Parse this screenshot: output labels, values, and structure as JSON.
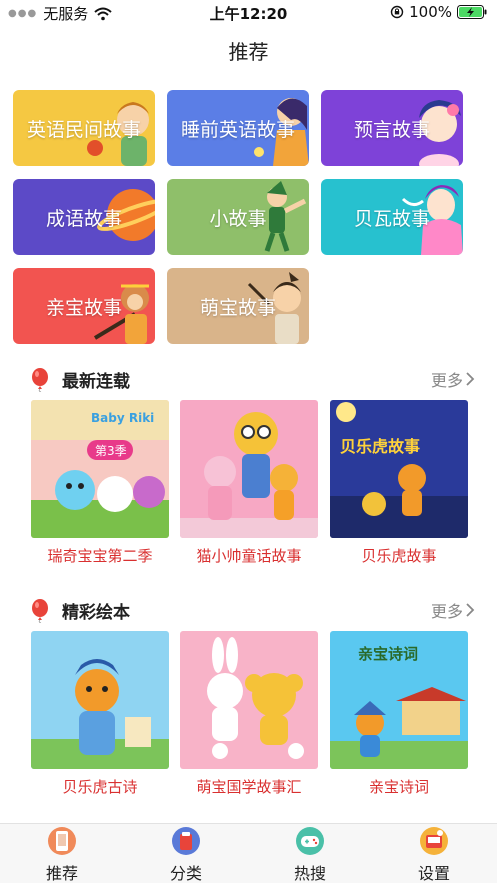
{
  "status_bar": {
    "carrier": "无服务",
    "time": "上午12:20",
    "battery": "100%",
    "icons": [
      "wifi-icon",
      "orientation-lock-icon",
      "battery-charging-icon"
    ]
  },
  "nav": {
    "title": "推荐"
  },
  "categories": [
    {
      "label": "英语民间故事",
      "color": "#f5c842"
    },
    {
      "label": "睡前英语故事",
      "color": "#5b7ee6"
    },
    {
      "label": "预言故事",
      "color": "#7e42d8"
    },
    {
      "label": "成语故事",
      "color": "#5c4ac7"
    },
    {
      "label": "小故事",
      "color": "#8fbf6a"
    },
    {
      "label": "贝瓦故事",
      "color": "#27c1cf"
    },
    {
      "label": "亲宝故事",
      "color": "#f25450"
    },
    {
      "label": "萌宝故事",
      "color": "#d9b48a"
    }
  ],
  "sections": [
    {
      "title": "最新连载",
      "more": "更多",
      "items": [
        {
          "title": "瑞奇宝宝第二季",
          "thumb_text": "Baby Riki",
          "thumb_text2": "第3季"
        },
        {
          "title": "猫小帅童话故事"
        },
        {
          "title": "贝乐虎故事",
          "thumb_text": "贝乐虎故事"
        }
      ]
    },
    {
      "title": "精彩绘本",
      "more": "更多",
      "items": [
        {
          "title": "贝乐虎古诗"
        },
        {
          "title": "萌宝国学故事汇"
        },
        {
          "title": "亲宝诗词",
          "thumb_text": "亲宝诗词"
        }
      ]
    }
  ],
  "tabs": [
    {
      "label": "推荐",
      "icon": "phone-tab-icon"
    },
    {
      "label": "分类",
      "icon": "category-tab-icon"
    },
    {
      "label": "热搜",
      "icon": "gamepad-tab-icon"
    },
    {
      "label": "设置",
      "icon": "settings-tab-icon"
    }
  ]
}
